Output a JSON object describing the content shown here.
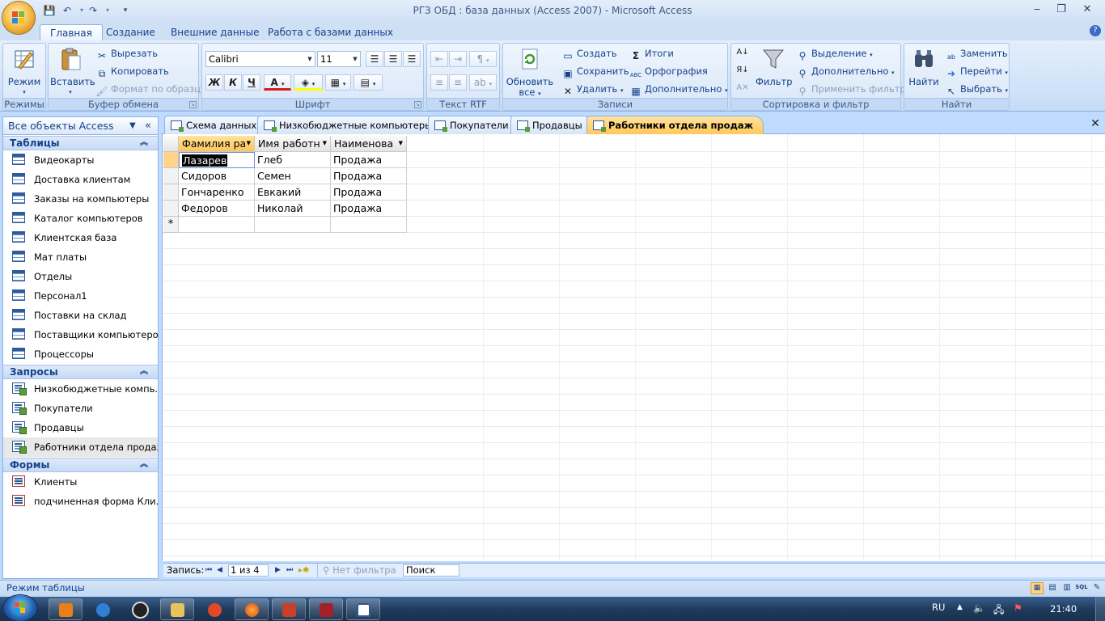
{
  "window": {
    "title": "РГЗ ОБД : база данных (Access 2007) - Microsoft Access",
    "minimize": "‒",
    "maximize": "❐",
    "close": "✕"
  },
  "ribbon": {
    "tabs": [
      "Главная",
      "Создание",
      "Внешние данные",
      "Работа с базами данных"
    ],
    "help": "?",
    "views": {
      "label": "Режимы",
      "mode_button": "Режим"
    },
    "clipboard": {
      "label": "Буфер обмена",
      "paste": "Вставить",
      "cut": "Вырезать",
      "copy": "Копировать",
      "format_painter": "Формат по образцу"
    },
    "font": {
      "label": "Шрифт",
      "font_name": "Calibri",
      "font_size": "11",
      "bold": "Ж",
      "italic": "К",
      "underline": "Ч",
      "font_color_letter": "A"
    },
    "rich_text": {
      "label": "Текст RTF"
    },
    "records": {
      "label": "Записи",
      "refresh_line1": "Обновить",
      "refresh_line2": "все",
      "new": "Создать",
      "save": "Сохранить",
      "delete": "Удалить",
      "totals": "Итоги",
      "spelling": "Орфография",
      "more": "Дополнительно"
    },
    "sort_filter": {
      "label": "Сортировка и фильтр",
      "filter": "Фильтр",
      "selection": "Выделение",
      "advanced": "Дополнительно",
      "toggle_filter": "Применить фильтр"
    },
    "find": {
      "label": "Найти",
      "find": "Найти",
      "replace": "Заменить",
      "goto": "Перейти",
      "select": "Выбрать"
    }
  },
  "nav_pane": {
    "header": "Все объекты Access",
    "sections": {
      "tables": {
        "title": "Таблицы",
        "items": [
          "Видеокарты",
          "Доставка клиентам",
          "Заказы на компьютеры",
          "Каталог компьютеров",
          "Клиентская база",
          "Мат платы",
          "Отделы",
          "Персонал1",
          "Поставки на склад",
          "Поставщики компьютеров",
          "Процессоры"
        ]
      },
      "queries": {
        "title": "Запросы",
        "items": [
          "Низкобюджетные компь...",
          "Покупатели",
          "Продавцы",
          "Работники отдела продаж"
        ]
      },
      "forms": {
        "title": "Формы",
        "items": [
          "Клиенты",
          "подчиненная форма Кли..."
        ]
      }
    }
  },
  "doc_tabs": [
    "Схема данных",
    "Низкобюджетные компьютеры",
    "Покупатели",
    "Продавцы",
    "Работники отдела продаж"
  ],
  "datasheet": {
    "columns": [
      "Фамилия ра",
      "Имя работн",
      "Наименова"
    ],
    "rows": [
      [
        "Лазарев",
        "Глеб",
        "Продажа"
      ],
      [
        "Сидоров",
        "Семен",
        "Продажа"
      ],
      [
        "Гончаренко",
        "Евкакий",
        "Продажа"
      ],
      [
        "Федоров",
        "Николай",
        "Продажа"
      ]
    ],
    "new_row_marker": "*"
  },
  "record_nav": {
    "label": "Запись:",
    "current": "1 из 4",
    "no_filter": "Нет фильтра",
    "search": "Поиск"
  },
  "status": {
    "text": "Режим таблицы",
    "sql": "SQL"
  },
  "taskbar": {
    "lang": "RU",
    "time": "21:40"
  },
  "colors": {
    "accent": "#15428b",
    "active_tab": "#ffc85a",
    "ribbon": "#d3e4f8"
  }
}
